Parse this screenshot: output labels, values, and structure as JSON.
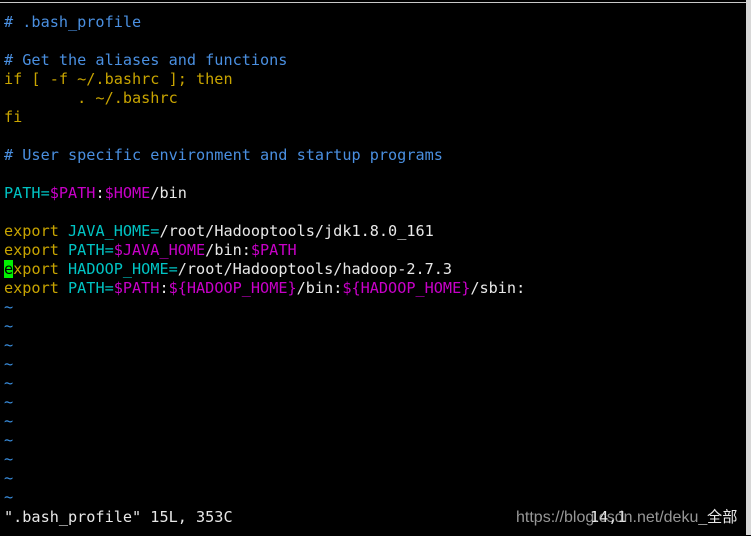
{
  "colors": {
    "comment": "#4a8fe0",
    "keyword": "#c8a400",
    "variable": "#00c4c4",
    "expansion": "#c800c8",
    "cursor": "#00f000",
    "tilde": "#3a8fe0"
  },
  "lines": [
    [
      {
        "t": "# .bash_profile",
        "c": "cm"
      }
    ],
    [],
    [
      {
        "t": "# Get the aliases and functions",
        "c": "cm"
      }
    ],
    [
      {
        "t": "if [ -f ~/.bashrc ]; then",
        "c": "kw"
      }
    ],
    [
      {
        "t": "        . ~/.bashrc",
        "c": "kw"
      }
    ],
    [
      {
        "t": "fi",
        "c": "kw"
      }
    ],
    [],
    [
      {
        "t": "# User specific environment and startup programs",
        "c": "cm"
      }
    ],
    [],
    [
      {
        "t": "PATH=",
        "c": "cy"
      },
      {
        "t": "$PATH",
        "c": "mg"
      },
      {
        "t": ":",
        "c": "wh"
      },
      {
        "t": "$HOME",
        "c": "mg"
      },
      {
        "t": "/bin",
        "c": "wh"
      }
    ],
    [],
    [
      {
        "t": "export ",
        "c": "kw"
      },
      {
        "t": "JAVA_HOME=",
        "c": "cy"
      },
      {
        "t": "/root/Hadooptools/jdk1.8.0_161",
        "c": "wh"
      }
    ],
    [
      {
        "t": "export ",
        "c": "kw"
      },
      {
        "t": "PATH=",
        "c": "cy"
      },
      {
        "t": "$JAVA_HOME",
        "c": "mg"
      },
      {
        "t": "/bin:",
        "c": "wh"
      },
      {
        "t": "$PATH",
        "c": "mg"
      }
    ],
    [
      {
        "t": "e",
        "c": "cur"
      },
      {
        "t": "xport ",
        "c": "kw"
      },
      {
        "t": "HADOOP_HOME=",
        "c": "cy"
      },
      {
        "t": "/root/Hadooptools/hadoop-2.7.3",
        "c": "wh"
      }
    ],
    [
      {
        "t": "export ",
        "c": "kw"
      },
      {
        "t": "PATH=",
        "c": "cy"
      },
      {
        "t": "$PATH",
        "c": "mg"
      },
      {
        "t": ":",
        "c": "wh"
      },
      {
        "t": "${HADOOP_HOME}",
        "c": "mg"
      },
      {
        "t": "/bin:",
        "c": "wh"
      },
      {
        "t": "${HADOOP_HOME}",
        "c": "mg"
      },
      {
        "t": "/sbin:",
        "c": "wh"
      }
    ]
  ],
  "tilde_count": 11,
  "tilde": "~",
  "status": {
    "file_info": "\".bash_profile\" 15L, 353C",
    "position": "14,1",
    "scroll": "全部"
  },
  "watermark": "https://blog.csdn.net/deku_"
}
